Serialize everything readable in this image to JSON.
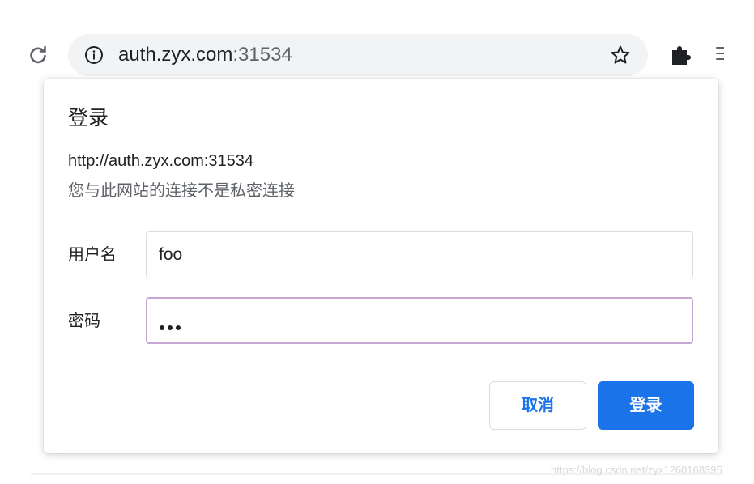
{
  "browser": {
    "url_host": "auth.zyx.com",
    "url_port": ":31534",
    "icons": [
      "reload-icon",
      "info-icon",
      "star-icon",
      "extensions-icon",
      "menu-icon"
    ]
  },
  "dialog": {
    "title": "登录",
    "origin": "http://auth.zyx.com:31534",
    "warning": "您与此网站的连接不是私密连接",
    "username_label": "用户名",
    "username_value": "foo",
    "password_label": "密码",
    "password_mask_count": 3,
    "cancel_label": "取消",
    "login_label": "登录"
  },
  "colors": {
    "primary": "#1a73e8",
    "focus_border": "#c8a6d4",
    "omnibox_bg": "#f1f3f4"
  },
  "watermark": "https://blog.csdn.net/zyx1260168395"
}
